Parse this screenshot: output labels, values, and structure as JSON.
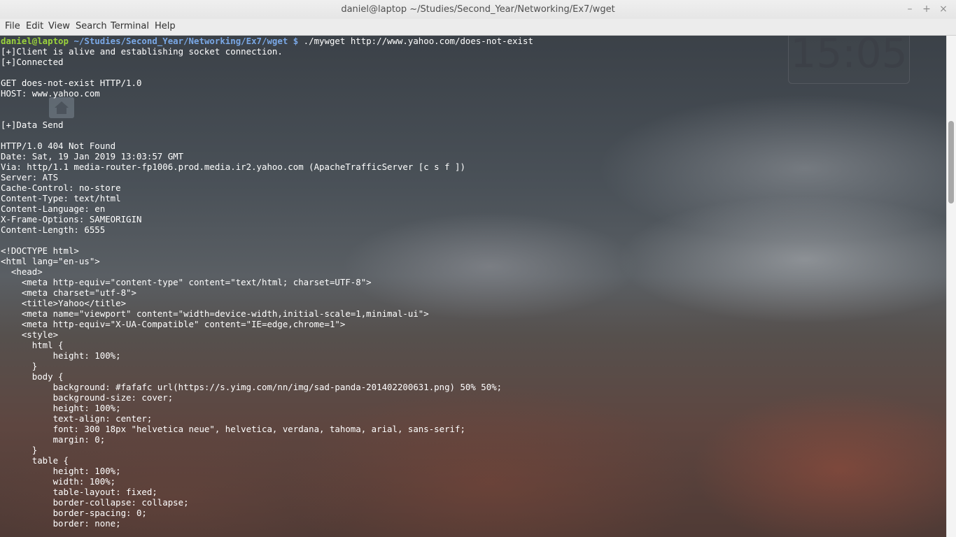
{
  "window": {
    "title": "daniel@laptop ~/Studies/Second_Year/Networking/Ex7/wget",
    "controls": {
      "minimize": "–",
      "maximize": "+",
      "close": "×"
    }
  },
  "menubar": {
    "items": [
      "File",
      "Edit",
      "View",
      "Search",
      "Terminal",
      "Help"
    ]
  },
  "desktop": {
    "clock": "15:05"
  },
  "terminal": {
    "prompt": {
      "user_host": "daniel@laptop",
      "path": " ~/Studies/Second_Year/Networking/Ex7/wget $",
      "command": " ./mywget http://www.yahoo.com/does-not-exist"
    },
    "output": "[+]Client is alive and establishing socket connection.\n[+]Connected\n\nGET does-not-exist HTTP/1.0\nHOST: www.yahoo.com\n\n\n[+]Data Send\n\nHTTP/1.0 404 Not Found\nDate: Sat, 19 Jan 2019 13:03:57 GMT\nVia: http/1.1 media-router-fp1006.prod.media.ir2.yahoo.com (ApacheTrafficServer [c s f ])\nServer: ATS\nCache-Control: no-store\nContent-Type: text/html\nContent-Language: en\nX-Frame-Options: SAMEORIGIN\nContent-Length: 6555\n\n<!DOCTYPE html>\n<html lang=\"en-us\">\n  <head>\n    <meta http-equiv=\"content-type\" content=\"text/html; charset=UTF-8\">\n    <meta charset=\"utf-8\">\n    <title>Yahoo</title>\n    <meta name=\"viewport\" content=\"width=device-width,initial-scale=1,minimal-ui\">\n    <meta http-equiv=\"X-UA-Compatible\" content=\"IE=edge,chrome=1\">\n    <style>\n      html {\n          height: 100%;\n      }\n      body {\n          background: #fafafc url(https://s.yimg.com/nn/img/sad-panda-201402200631.png) 50% 50%;\n          background-size: cover;\n          height: 100%;\n          text-align: center;\n          font: 300 18px \"helvetica neue\", helvetica, verdana, tahoma, arial, sans-serif;\n          margin: 0;\n      }\n      table {\n          height: 100%;\n          width: 100%;\n          table-layout: fixed;\n          border-collapse: collapse;\n          border-spacing: 0;\n          border: none;"
  }
}
